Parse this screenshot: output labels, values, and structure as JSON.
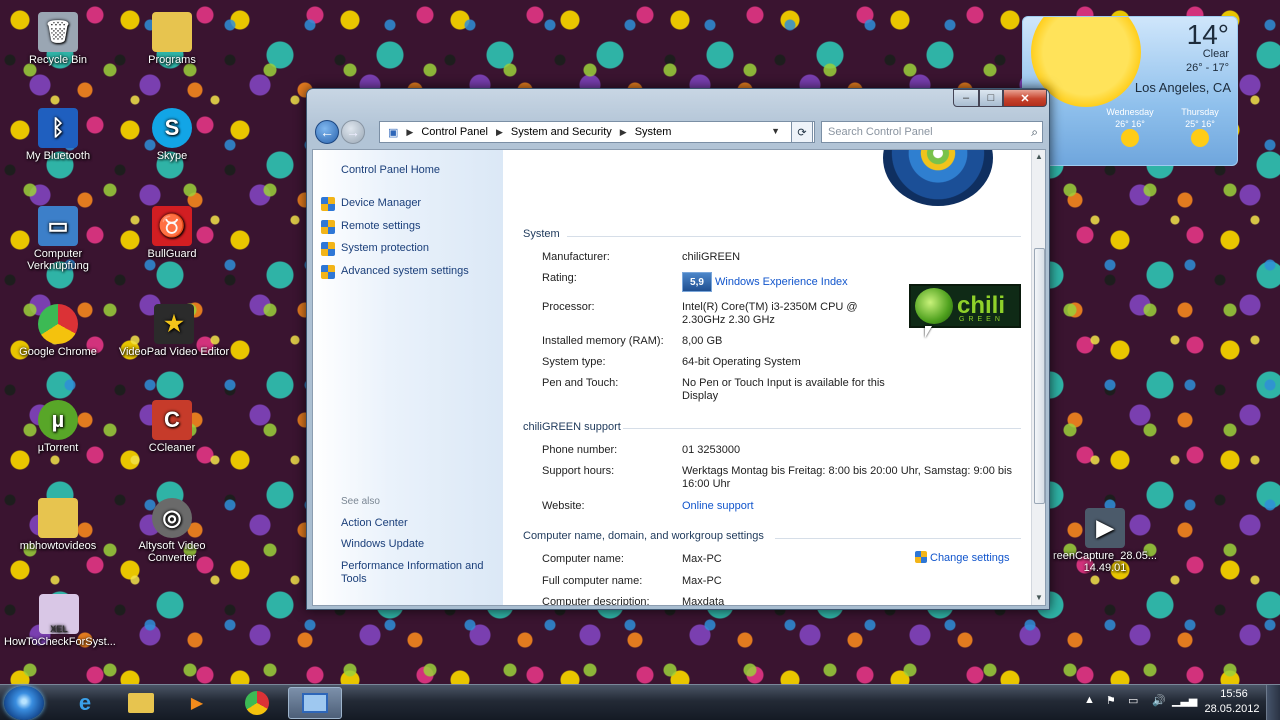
{
  "desktop": {
    "icons": [
      {
        "label": "Recycle Bin",
        "color": "#9aa6b3"
      },
      {
        "label": "Programs",
        "color": "#e7c44f"
      },
      {
        "label": "My Bluetooth",
        "color": "#1f5fbf"
      },
      {
        "label": "Skype",
        "color": "#12a5e6"
      },
      {
        "label": "Computer Verknüpfung",
        "color": "#3c7fc9"
      },
      {
        "label": "BullGuard",
        "color": "#d21e22"
      },
      {
        "label": "Google Chrome",
        "color": "#3aa34a"
      },
      {
        "label": "VideoPad Video Editor",
        "color": "#2b2b2b"
      },
      {
        "label": "µTorrent",
        "color": "#58a628"
      },
      {
        "label": "CCleaner",
        "color": "#c63b2a"
      },
      {
        "label": "mbhowtovideos",
        "color": "#e7c44f"
      },
      {
        "label": "Altysoft Video Converter",
        "color": "#6a6a6a"
      },
      {
        "label": "HowToCheckForSyst...",
        "color": "#d9c7e6"
      },
      {
        "label": "reenCapture_28.05... 14.49.01",
        "color": "#4b5a6a"
      }
    ],
    "xel_badge": "XEL"
  },
  "weather": {
    "temp": "14°",
    "condition": "Clear",
    "range": "26° - 17°",
    "city": "Los Angeles, CA",
    "forecast": [
      {
        "day": "Wednesday",
        "temps": "26° 16°"
      },
      {
        "day": "Thursday",
        "temps": "25° 16°"
      }
    ]
  },
  "window": {
    "controls": {
      "minimize": "–",
      "maximize": "□",
      "close": "✕"
    },
    "breadcrumb": [
      "Control Panel",
      "System and Security",
      "System"
    ],
    "search_placeholder": "Search Control Panel",
    "sidebar": {
      "home": "Control Panel Home",
      "tasks": [
        "Device Manager",
        "Remote settings",
        "System protection",
        "Advanced system settings"
      ],
      "see_also_title": "See also",
      "see_also": [
        "Action Center",
        "Windows Update",
        "Performance Information and Tools"
      ]
    },
    "system": {
      "title": "System",
      "manufacturer_label": "Manufacturer:",
      "manufacturer": "chiliGREEN",
      "rating_label": "Rating:",
      "rating_score": "5,9",
      "rating_link": "Windows Experience Index",
      "processor_label": "Processor:",
      "processor": "Intel(R) Core(TM) i3-2350M CPU @ 2.30GHz 2.30 GHz",
      "ram_label": "Installed memory (RAM):",
      "ram": "8,00 GB",
      "type_label": "System type:",
      "type": "64-bit Operating System",
      "pen_label": "Pen and Touch:",
      "pen": "No Pen or Touch Input is available for this Display"
    },
    "oem_logo": {
      "text": "chili",
      "subtext": "GREEN"
    },
    "support": {
      "title": "chiliGREEN support",
      "phone_label": "Phone number:",
      "phone": "01 3253000",
      "hours_label": "Support hours:",
      "hours": "Werktags Montag bis Freitag: 8:00 bis 20:00 Uhr, Samstag: 9:00 bis 16:00 Uhr",
      "website_label": "Website:",
      "website": "Online support"
    },
    "computer": {
      "title": "Computer name, domain, and workgroup settings",
      "name_label": "Computer name:",
      "name": "Max-PC",
      "full_label": "Full computer name:",
      "full": "Max-PC",
      "desc_label": "Computer description:",
      "desc": "Maxdata",
      "change_settings": "Change settings"
    }
  },
  "taskbar": {
    "time": "15:56",
    "date": "28.05.2012"
  }
}
